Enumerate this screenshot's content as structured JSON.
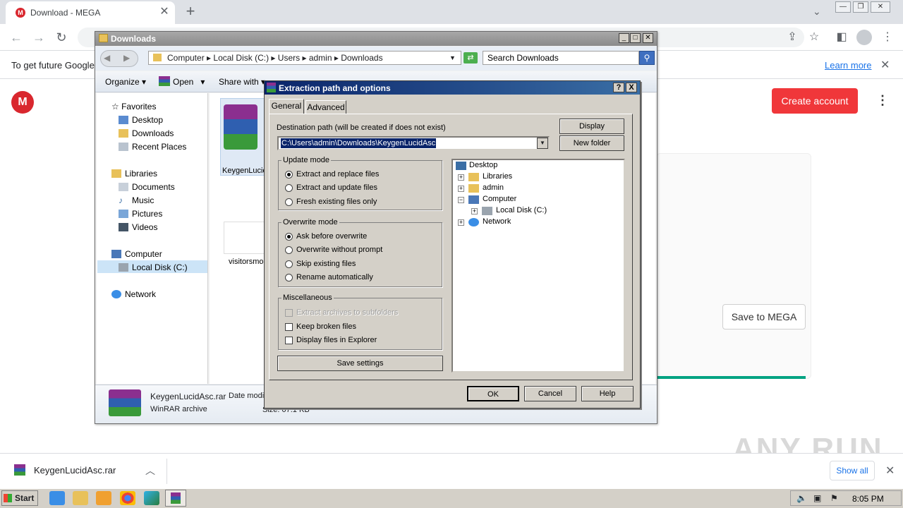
{
  "browser": {
    "tab_title": "Download - MEGA",
    "new_tab": "+",
    "infobar_text": "To get future Google",
    "learn_more": "Learn more"
  },
  "mega": {
    "logo_letter": "M",
    "create_account": "Create account",
    "save_to_mega": "Save to MEGA",
    "progress_fraction": 1.0,
    "watermark": "ANY RUN"
  },
  "download_shelf": {
    "file_name": "KeygenLucidAsc.rar",
    "show_all": "Show all"
  },
  "taskbar": {
    "start": "Start",
    "clock": "8:05 PM"
  },
  "explorer": {
    "title": "Downloads",
    "breadcrumb": [
      "Computer",
      "Local Disk (C:)",
      "Users",
      "admin",
      "Downloads"
    ],
    "search_placeholder": "Search Downloads",
    "commands": [
      "Organize",
      "Open",
      "Share with"
    ],
    "nav": {
      "favorites": "Favorites",
      "desktop": "Desktop",
      "downloads": "Downloads",
      "recent_places": "Recent Places",
      "libraries": "Libraries",
      "documents": "Documents",
      "music": "Music",
      "pictures": "Pictures",
      "videos": "Videos",
      "computer": "Computer",
      "local_disk": "Local Disk (C:)",
      "network": "Network"
    },
    "files": [
      {
        "name": "KeygenLucid",
        "type": "rar"
      },
      {
        "name": "visitorsmo",
        "type": "txt"
      }
    ],
    "details": {
      "name": "KeygenLucidAsc.rar",
      "date_label": "Date modi",
      "type": "WinRAR archive",
      "size": "Size: 07.1 KB"
    }
  },
  "dialog": {
    "title": "Extraction path and options",
    "help_btn": "?",
    "close_btn": "X",
    "tabs": [
      "General",
      "Advanced"
    ],
    "dest_label": "Destination path (will be created if does not exist)",
    "dest_value": "C:\\Users\\admin\\Downloads\\KeygenLucidAsc",
    "display_btn": "Display",
    "new_folder_btn": "New folder",
    "update_mode": {
      "title": "Update mode",
      "options": [
        "Extract and replace files",
        "Extract and update files",
        "Fresh existing files only"
      ],
      "selected": 0
    },
    "overwrite_mode": {
      "title": "Overwrite mode",
      "options": [
        "Ask before overwrite",
        "Overwrite without prompt",
        "Skip existing files",
        "Rename automatically"
      ],
      "selected": 0
    },
    "misc": {
      "title": "Miscellaneous",
      "options": [
        "Extract archives to subfolders",
        "Keep broken files",
        "Display files in Explorer"
      ]
    },
    "save_settings": "Save settings",
    "tree": [
      "Desktop",
      "Libraries",
      "admin",
      "Computer",
      "Local Disk (C:)",
      "Network"
    ],
    "ok": "OK",
    "cancel": "Cancel",
    "help": "Help"
  }
}
